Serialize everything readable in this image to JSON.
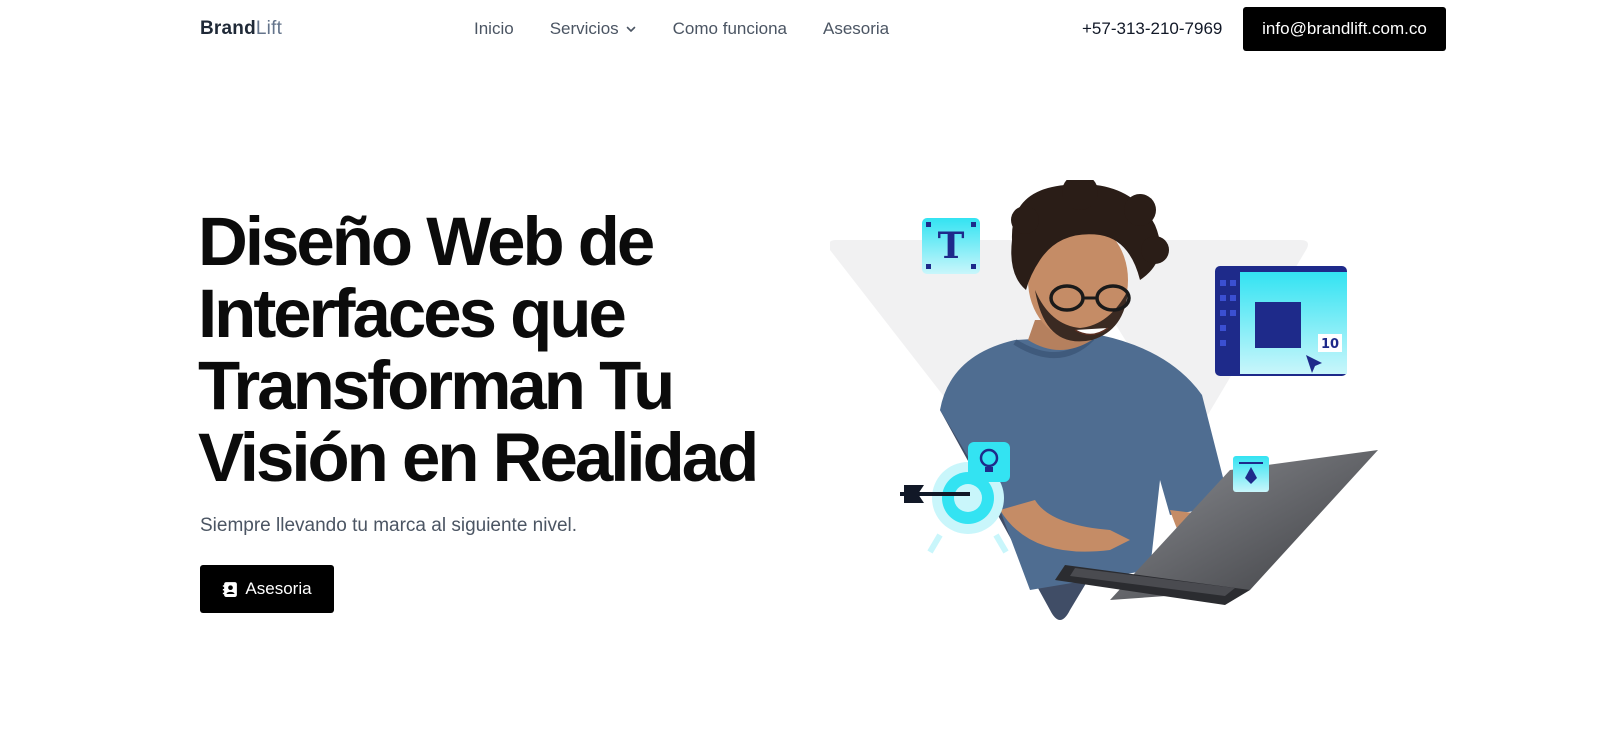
{
  "header": {
    "logo": {
      "strong": "Brand",
      "light": "Lift"
    },
    "nav": [
      {
        "label": "Inicio"
      },
      {
        "label": "Servicios",
        "has_dropdown": true,
        "icon": "chevron-down-icon"
      },
      {
        "label": "Como funciona"
      },
      {
        "label": "Asesoria"
      }
    ],
    "phone": "+57-313-210-7969",
    "email_button": "info@brandlift.com.co"
  },
  "hero": {
    "title_lines": [
      "Diseño Web de",
      "Interfaces que",
      "Transforman Tu",
      "Visión en Realidad"
    ],
    "subtitle": "Siempre llevando tu marca al siguiente nivel.",
    "cta": {
      "label": "Asesoria",
      "icon": "contact-card-icon"
    }
  },
  "illustration": {
    "text_icon_letter": "T",
    "layout_badge": "10"
  },
  "colors": {
    "primary_button": "#000000",
    "button_text": "#ffffff",
    "nav_text": "#4b5563",
    "accent_cyan": "#33e3f2",
    "accent_navy": "#1e2a8a"
  }
}
